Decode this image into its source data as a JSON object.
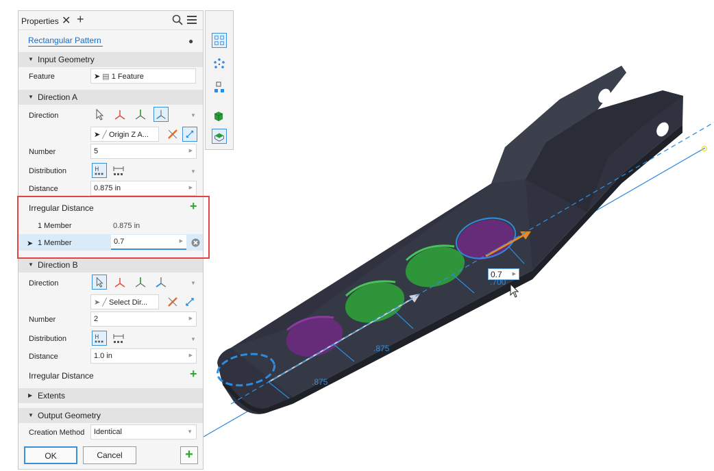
{
  "panel": {
    "tab_title": "Properties",
    "tab_close": "✕",
    "tab_add": "+",
    "feature_name": "Rectangular Pattern",
    "eye": "👁",
    "input_geometry": {
      "header": "Input Geometry",
      "feature_label": "Feature",
      "feature_value": "1 Feature"
    },
    "direction_a": {
      "header": "Direction A",
      "direction_label": "Direction",
      "axis_value": "Origin Z A...",
      "number_label": "Number",
      "number_value": "5",
      "distribution_label": "Distribution",
      "distance_label": "Distance",
      "distance_value": "0.875 in",
      "irregular_label": "Irregular Distance",
      "members": [
        {
          "label": "1 Member",
          "value": "0.875 in"
        },
        {
          "label": "1 Member",
          "value": "0.7"
        }
      ]
    },
    "direction_b": {
      "header": "Direction B",
      "direction_label": "Direction",
      "axis_value": "Select Dir...",
      "number_label": "Number",
      "number_value": "2",
      "distribution_label": "Distribution",
      "distance_label": "Distance",
      "distance_value": "1.0 in",
      "irregular_label": "Irregular Distance"
    },
    "extents": {
      "header": "Extents"
    },
    "output_geometry": {
      "header": "Output Geometry",
      "creation_label": "Creation Method",
      "creation_value": "Identical"
    },
    "ok_label": "OK",
    "cancel_label": "Cancel"
  },
  "viewport": {
    "dim_labels": [
      ".875",
      ".875",
      ".700"
    ],
    "active_dim_value": "0.7"
  },
  "colors": {
    "accent": "#1a6cc4",
    "highlight_border": "#e0443f",
    "add_green": "#2aa62a",
    "selection_blue": "#3b8ed8",
    "dimension_blue": "#2c8de0",
    "part_dark": "#2f3340",
    "pattern_purple": "#7a2a8a",
    "pattern_green": "#2f9a3a"
  }
}
